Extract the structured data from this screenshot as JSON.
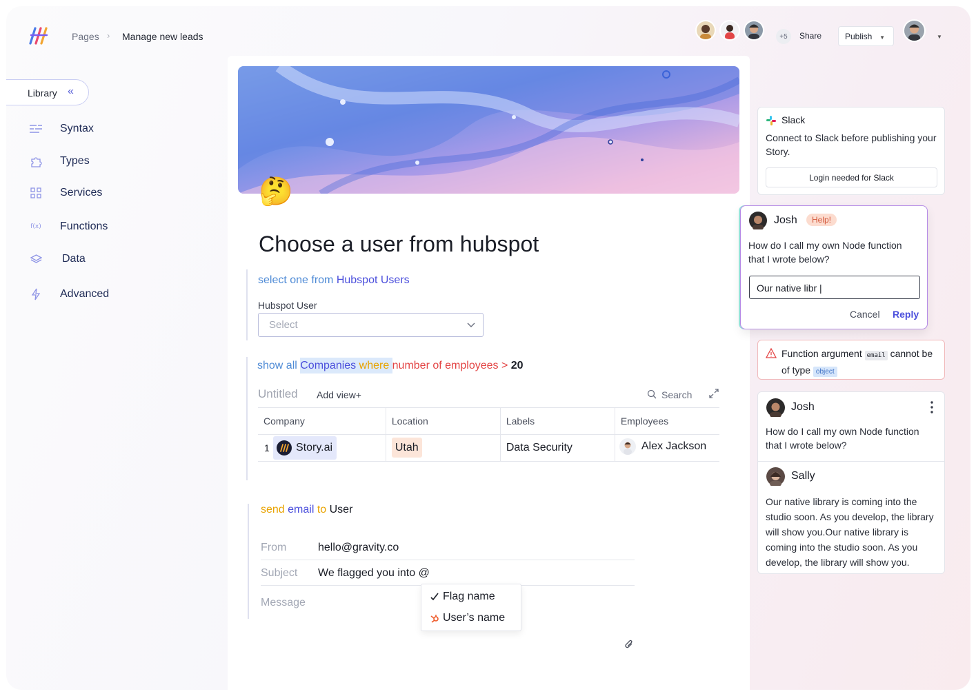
{
  "header": {
    "breadcrumb_root": "Pages",
    "breadcrumb_sep": "›",
    "breadcrumb_current": "Manage new leads",
    "collaborators_extra": "+5",
    "share_label": "Share",
    "publish_label": "Publish"
  },
  "sidebar": {
    "library_label": "Library",
    "collapse_glyph": "«",
    "items": [
      {
        "label": "Syntax",
        "icon": "syntax-icon"
      },
      {
        "label": "Types",
        "icon": "puzzle-icon"
      },
      {
        "label": "Services",
        "icon": "grid-icon"
      },
      {
        "label": "Functions",
        "icon": "function-icon"
      },
      {
        "label": "Data",
        "icon": "layers-icon"
      },
      {
        "label": "Advanced",
        "icon": "bolt-icon"
      }
    ]
  },
  "page": {
    "emoji": "🤔",
    "title": "Choose a user from hubspot",
    "block1": {
      "w1": "select one from ",
      "w2": "Hubspot Users",
      "field_label": "Hubspot User",
      "select_placeholder": "Select"
    },
    "block2": {
      "w1": "show all ",
      "w2": "Companies",
      "w3": " where ",
      "w4": "number of employees > ",
      "w5": "20",
      "table_title": "Untitled",
      "add_view": "Add view+",
      "search": "Search",
      "columns": [
        "Company",
        "Location",
        "Labels",
        "Employees"
      ],
      "rows": [
        {
          "num": "1",
          "company": "Story.ai",
          "location": "Utah",
          "labels": "Data Security",
          "employee": "Alex Jackson"
        }
      ]
    },
    "block3": {
      "w1": "send ",
      "w2": "email",
      "w3": " to ",
      "w4": "User",
      "from_label": "From",
      "from_value": "hello@gravity.co",
      "subject_label": "Subject",
      "subject_value": "We flagged you into @",
      "message_label": "Message",
      "mentions": [
        "Flag name",
        "User’s name"
      ]
    }
  },
  "panel": {
    "slack": {
      "title": "Slack",
      "desc": "Connect to Slack before publishing your Story.",
      "button": "Login needed for Slack"
    },
    "help_comment": {
      "author": "Josh",
      "badge": "Help!",
      "text": "How do I call my own Node function that I wrote below?",
      "reply_value": "Our native libr |",
      "cancel": "Cancel",
      "reply": "Reply"
    },
    "error": {
      "w1": "Function argument ",
      "code": "email",
      "w2": " cannot be of type ",
      "type": "object"
    },
    "thread": [
      {
        "author": "Josh",
        "text": "How do I call my own Node function that I wrote below?"
      },
      {
        "author": "Sally",
        "text": "Our native library is coming into the studio soon. As you develop, the library will show you.Our native library is coming into the studio soon. As you develop, the library will show you."
      }
    ]
  },
  "colors": {
    "accent": "#4b4fdc",
    "keyword_blue": "#4f8bd6",
    "keyword_orange": "#e9a300",
    "keyword_red": "#e34545",
    "error_border": "#f1b9bb"
  }
}
